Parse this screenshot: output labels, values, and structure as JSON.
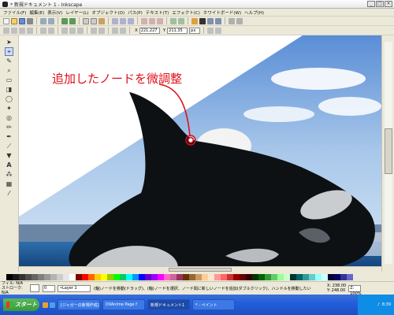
{
  "window": {
    "title": "* 新規ドキュメント 1 - Inkscape"
  },
  "menubar": {
    "items": [
      "ファイル(F)",
      "編集(E)",
      "表示(V)",
      "レイヤー(L)",
      "オブジェクト(O)",
      "パス(P)",
      "テキスト(T)",
      "エフェクト(C)",
      "ホワイトボード(W)",
      "ヘルプ(H)"
    ]
  },
  "toolbar2": {
    "x_label": "X",
    "x_value": "221.227",
    "y_label": "Y",
    "y_value": "211.35",
    "unit": "px"
  },
  "canvas": {
    "annotation_text": "追加したノードを微調整",
    "annotation_color": "#e0101a"
  },
  "statusbar": {
    "fill_label": "フィル:",
    "stroke_label": "ストローク:",
    "fill_value": "N/A",
    "stroke_value": "N/A",
    "opacity": "0",
    "layer": "•Layer 1",
    "message": "(軸)ノードを移動(ドラッグ)、(軸)ノードを選択、ノード間に新しいノードを追加(ダブルクリック)、ハンドルを移動したい",
    "cursor_x": "X: 238.00",
    "cursor_y": "Y: 248.00",
    "zoom": "Z: 100%"
  },
  "taskbar": {
    "start_label": "スタート",
    "tasks": [
      {
        "label": "[ジャガーの新規作成]",
        "active": false
      },
      {
        "label": "DVAnime Page f",
        "active": false
      },
      {
        "label": "新規ドキュメント1",
        "active": true
      },
      {
        "label": "* - ペイント",
        "active": false
      }
    ],
    "clock": "8:39"
  },
  "palette_colors": [
    "#000000",
    "#1a1a1a",
    "#333333",
    "#4d4d4d",
    "#666666",
    "#808080",
    "#999999",
    "#b3b3b3",
    "#cccccc",
    "#e6e6e6",
    "#ffffff",
    "#800000",
    "#ff0000",
    "#ff6600",
    "#ffcc00",
    "#ffff00",
    "#99cc00",
    "#00ff00",
    "#00cc66",
    "#00ffff",
    "#0099ff",
    "#0000ff",
    "#6600cc",
    "#9900ff",
    "#ff00ff",
    "#ff66cc",
    "#cc6699",
    "#993366",
    "#663300",
    "#996633",
    "#cc9966",
    "#ffcc99",
    "#ffe6cc",
    "#ff9999",
    "#ff6666",
    "#cc3333",
    "#990000",
    "#660000",
    "#330000",
    "#003300",
    "#006600",
    "#339933",
    "#66cc66",
    "#99ff99",
    "#ccffcc",
    "#003333",
    "#006666",
    "#339999",
    "#66cccc",
    "#99ffff",
    "#ccffff",
    "#000033",
    "#000066",
    "#333399",
    "#6666cc"
  ]
}
